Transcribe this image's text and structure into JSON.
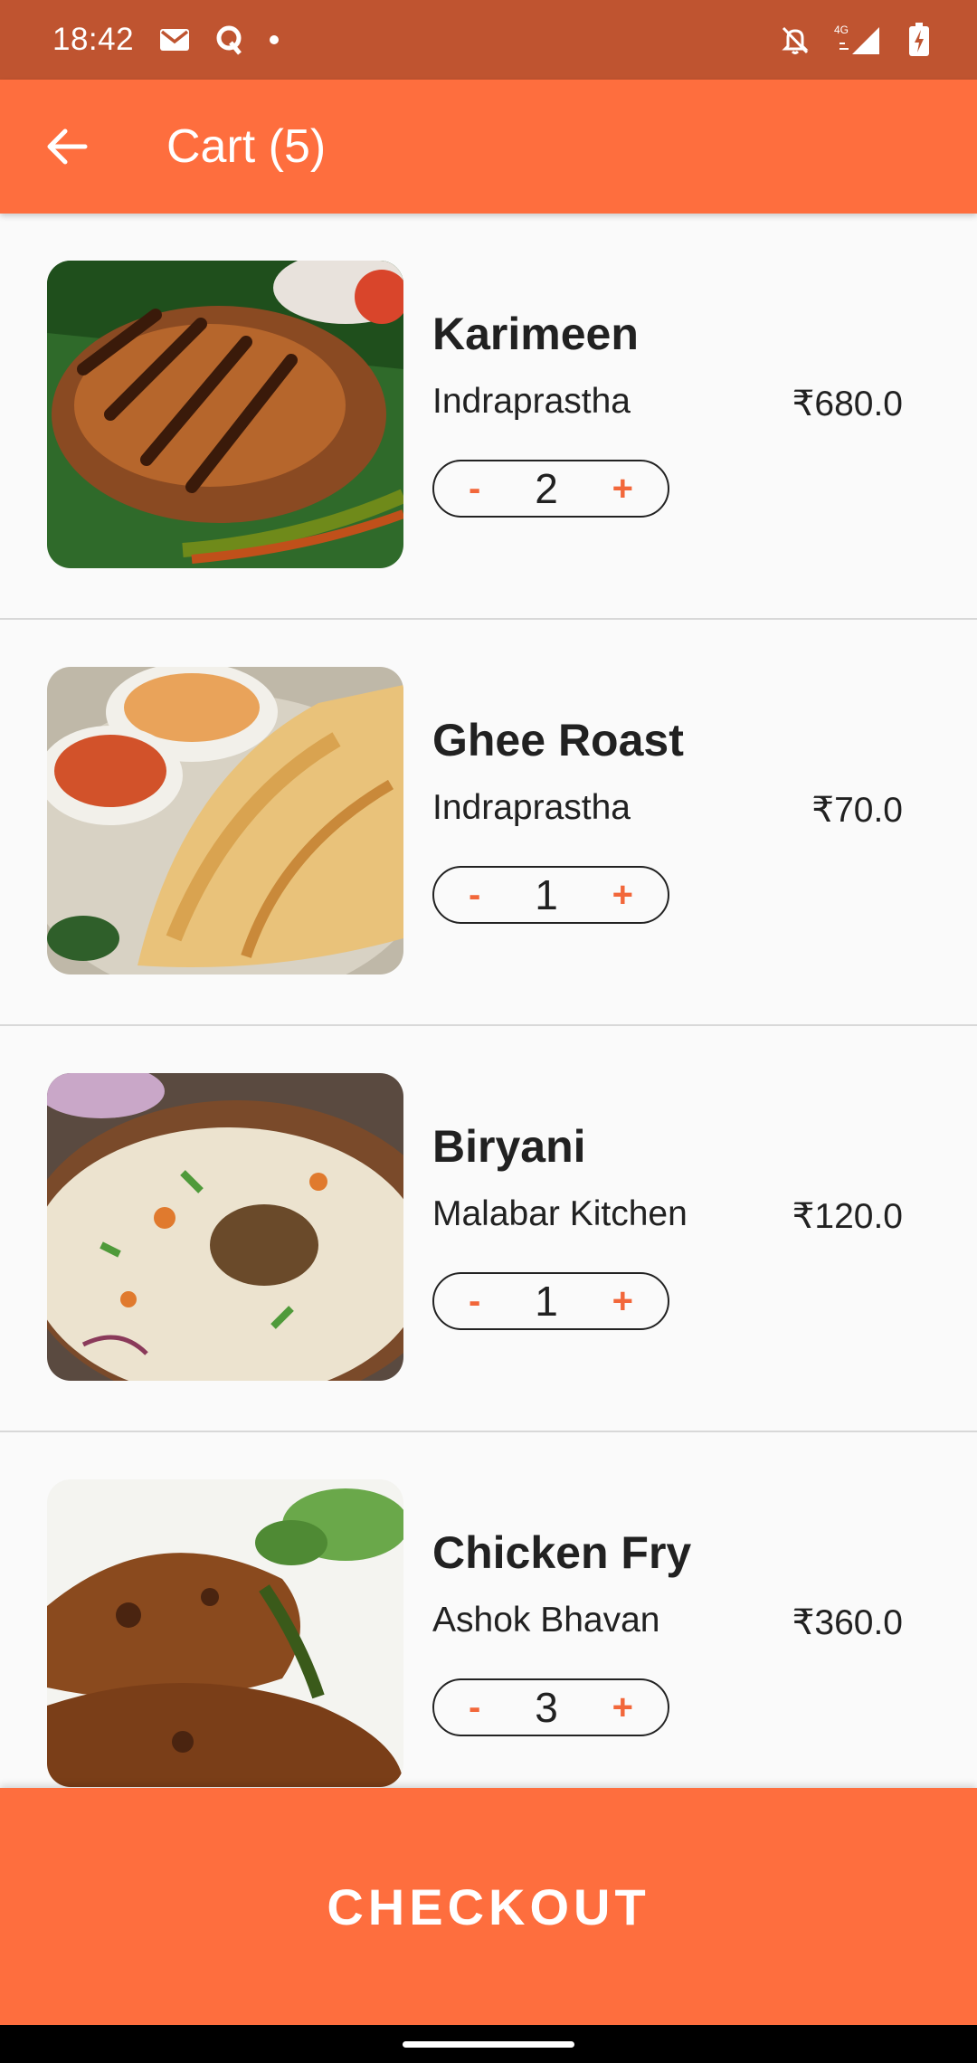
{
  "status_bar": {
    "time": "18:42",
    "icons_left": [
      "gmail-icon",
      "quora-icon",
      "notification-dot"
    ],
    "icons_right": [
      "bell-off-icon",
      "4g-signal-icon",
      "battery-charging-icon"
    ],
    "network_label": "4G"
  },
  "app_bar": {
    "title": "Cart (5)",
    "background_color": "#fe6e3e"
  },
  "cart_items": [
    {
      "name": "Karimeen",
      "restaurant": "Indraprastha",
      "price": "₹680.0",
      "quantity": "2",
      "image": "fried-fish-image"
    },
    {
      "name": "Ghee Roast",
      "restaurant": "Indraprastha",
      "price": "₹70.0",
      "quantity": "1",
      "image": "dosa-image"
    },
    {
      "name": "Biryani",
      "restaurant": "Malabar Kitchen",
      "price": "₹120.0",
      "quantity": "1",
      "image": "biryani-image"
    },
    {
      "name": "Chicken Fry",
      "restaurant": "Ashok Bhavan",
      "price": "₹360.0",
      "quantity": "3",
      "image": "chicken-fry-image"
    }
  ],
  "stepper": {
    "minus_label": "-",
    "plus_label": "+",
    "accent_color": "#f2673a"
  },
  "checkout": {
    "label": "CHECKOUT"
  },
  "colors": {
    "status_bar": "#bf5430",
    "accent": "#fe6e3e"
  }
}
